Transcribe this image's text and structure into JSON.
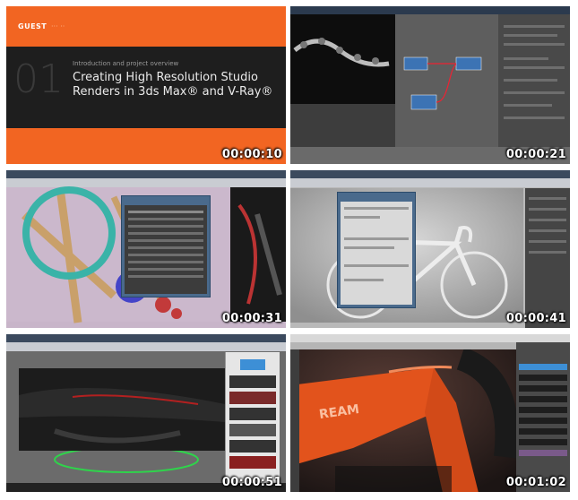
{
  "tiles": [
    {
      "timestamp": "00:00:10",
      "brand": "GUEST",
      "brand_sub": "··· ··",
      "chapter_number": "01",
      "chapter_label": "Introduction and project overview",
      "title": "Creating High Resolution Studio Renders in 3ds Max® and V-Ray®"
    },
    {
      "timestamp": "00:00:21"
    },
    {
      "timestamp": "00:00:31"
    },
    {
      "timestamp": "00:00:41"
    },
    {
      "timestamp": "00:00:51"
    },
    {
      "timestamp": "00:01:02",
      "frame_text": "REAM"
    }
  ],
  "colors": {
    "accent": "#f26522",
    "dark": "#1e1e1e",
    "bike_orange": "#e2531c",
    "ui_blue": "#4a6a8c"
  }
}
